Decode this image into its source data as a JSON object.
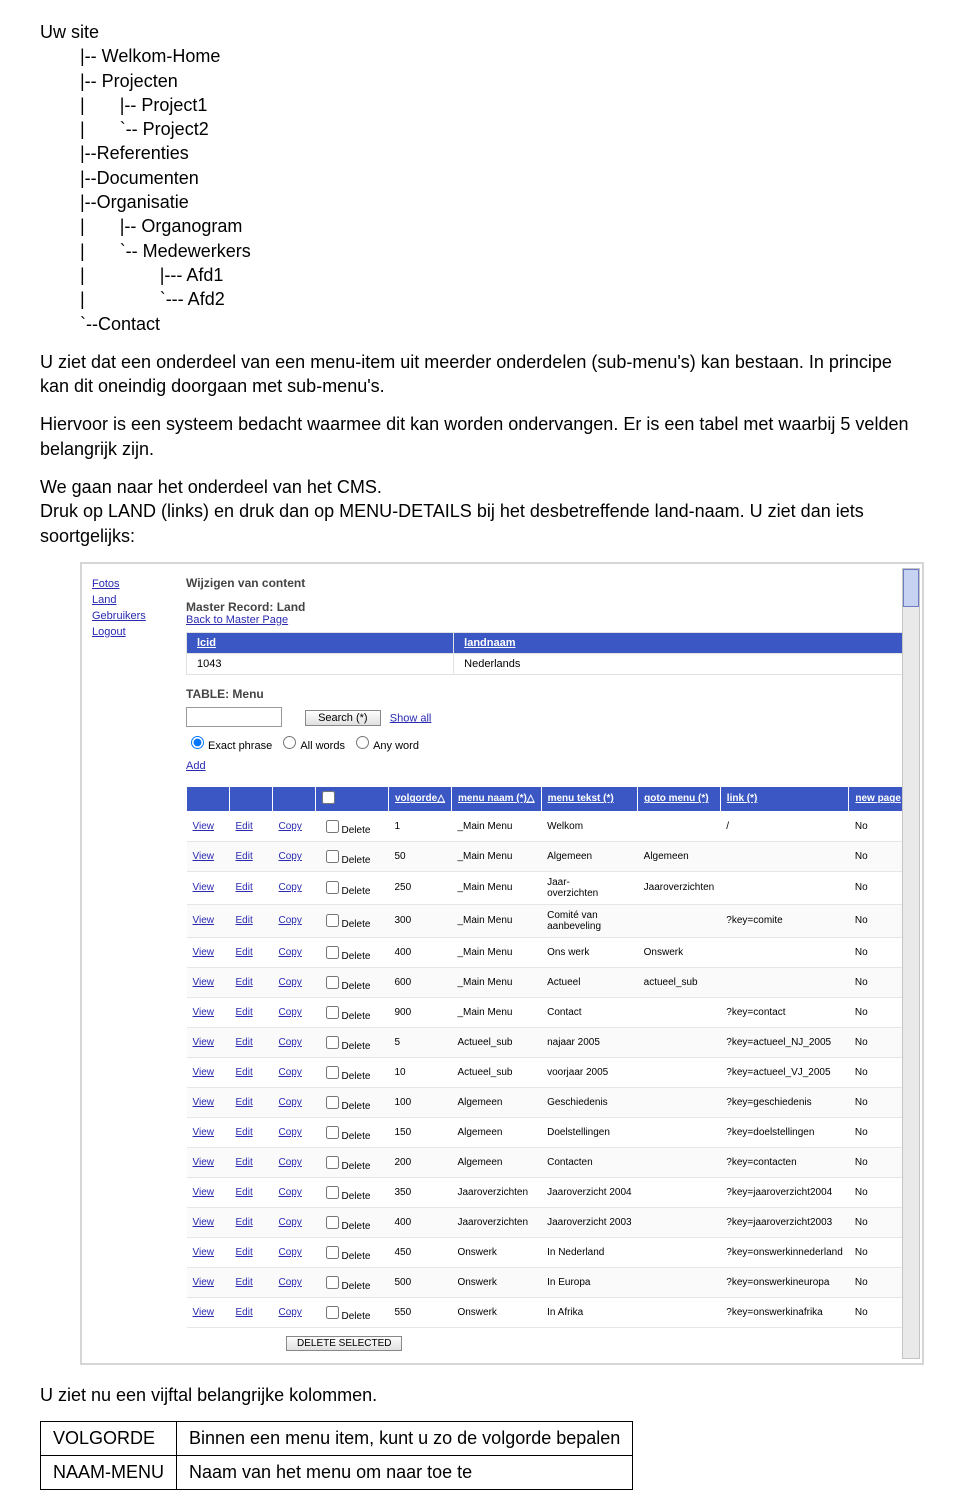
{
  "tree": "Uw site\n        |-- Welkom-Home\n        |-- Projecten\n        |       |-- Project1\n        |       `-- Project2\n        |--Referenties\n        |--Documenten\n        |--Organisatie\n        |       |-- Organogram\n        |       `-- Medewerkers\n        |               |--- Afd1\n        |               `--- Afd2\n        `--Contact",
  "p1": "U ziet dat een onderdeel van een menu-item uit meerder onderdelen (sub-menu's) kan bestaan. In principe kan dit oneindig doorgaan met sub-menu's.",
  "p2": "Hiervoor is een systeem bedacht waarmee dit kan worden ondervangen. Er is een tabel met waarbij 5 velden belangrijk zijn.",
  "p3": "We gaan naar het onderdeel van het CMS.\nDruk op LAND (links) en druk dan op MENU-DETAILS bij het desbetreffende land-naam. U ziet dan iets soortgelijks:",
  "nav": {
    "fotos": "Fotos",
    "land": "Land",
    "gebruikers": "Gebruikers",
    "logout": "Logout"
  },
  "titles": {
    "wijzigen": "Wijzigen van content",
    "master": "Master Record: Land",
    "back": "Back to Master Page",
    "tbl": "TABLE: Menu"
  },
  "land": {
    "col1": "lcid",
    "col2": "landnaam",
    "v1": "1043",
    "v2": "Nederlands"
  },
  "search": {
    "btn": "Search   (*)",
    "show": "Show all",
    "exact": "Exact phrase",
    "all": "All words",
    "any": "Any word"
  },
  "add_label": "Add",
  "gridhead": {
    "volgorde": "volgorde△",
    "menunaam": "menu naam (*)△",
    "menutekst": "menu tekst (*)",
    "gotomenu": "goto menu (*)",
    "link": "link (*)",
    "newpage": "new page"
  },
  "actions": {
    "view": "View",
    "edit": "Edit",
    "copy": "Copy",
    "del": "Delete",
    "delsel": "DELETE SELECTED"
  },
  "rows": [
    {
      "ord": "1",
      "mn": "_Main Menu",
      "mt": "Welkom",
      "gm": "",
      "ln": "/",
      "np": "No"
    },
    {
      "ord": "50",
      "mn": "_Main Menu",
      "mt": "Algemeen",
      "gm": "Algemeen",
      "ln": "",
      "np": "No"
    },
    {
      "ord": "250",
      "mn": "_Main Menu",
      "mt": "Jaar-\noverzichten",
      "gm": "Jaaroverzichten",
      "ln": "",
      "np": "No"
    },
    {
      "ord": "300",
      "mn": "_Main Menu",
      "mt": "Comité van\naanbeveling",
      "gm": "",
      "ln": "?key=comite",
      "np": "No"
    },
    {
      "ord": "400",
      "mn": "_Main Menu",
      "mt": "Ons werk",
      "gm": "Onswerk",
      "ln": "",
      "np": "No"
    },
    {
      "ord": "600",
      "mn": "_Main Menu",
      "mt": "Actueel",
      "gm": "actueel_sub",
      "ln": "",
      "np": "No"
    },
    {
      "ord": "900",
      "mn": "_Main Menu",
      "mt": "Contact",
      "gm": "",
      "ln": "?key=contact",
      "np": "No"
    },
    {
      "ord": "5",
      "mn": "Actueel_sub",
      "mt": "najaar 2005",
      "gm": "",
      "ln": "?key=actueel_NJ_2005",
      "np": "No"
    },
    {
      "ord": "10",
      "mn": "Actueel_sub",
      "mt": "voorjaar 2005",
      "gm": "",
      "ln": "?key=actueel_VJ_2005",
      "np": "No"
    },
    {
      "ord": "100",
      "mn": "Algemeen",
      "mt": "Geschiedenis",
      "gm": "",
      "ln": "?key=geschiedenis",
      "np": "No"
    },
    {
      "ord": "150",
      "mn": "Algemeen",
      "mt": "Doelstellingen",
      "gm": "",
      "ln": "?key=doelstellingen",
      "np": "No"
    },
    {
      "ord": "200",
      "mn": "Algemeen",
      "mt": "Contacten",
      "gm": "",
      "ln": "?key=contacten",
      "np": "No"
    },
    {
      "ord": "350",
      "mn": "Jaaroverzichten",
      "mt": "Jaaroverzicht 2004",
      "gm": "",
      "ln": "?key=jaaroverzicht2004",
      "np": "No"
    },
    {
      "ord": "400",
      "mn": "Jaaroverzichten",
      "mt": "Jaaroverzicht 2003",
      "gm": "",
      "ln": "?key=jaaroverzicht2003",
      "np": "No"
    },
    {
      "ord": "450",
      "mn": "Onswerk",
      "mt": "In Nederland",
      "gm": "",
      "ln": "?key=onswerkinnederland",
      "np": "No"
    },
    {
      "ord": "500",
      "mn": "Onswerk",
      "mt": "In Europa",
      "gm": "",
      "ln": "?key=onswerkineuropa",
      "np": "No"
    },
    {
      "ord": "550",
      "mn": "Onswerk",
      "mt": "In Afrika",
      "gm": "",
      "ln": "?key=onswerkinafrika",
      "np": "No"
    }
  ],
  "footer": "U ziet nu een vijftal belangrijke kolommen.",
  "bottom": {
    "volgorde": "VOLGORDE",
    "naammenu": "NAAM-MENU",
    "volgorde_desc": "Binnen een menu item, kunt u zo de volgorde bepalen",
    "naammenu_desc": "Naam van het menu om naar toe te"
  }
}
